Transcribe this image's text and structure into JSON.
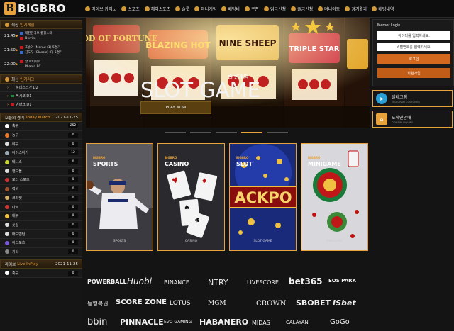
{
  "header": {
    "logo_mark": "B",
    "logo_text": "BIGBRO",
    "nav": [
      "라이브 카지노",
      "스포츠",
      "해외스포츠",
      "슬롯",
      "미니게임",
      "배팅비",
      "쿠폰",
      "입금신청",
      "출금신청",
      "머니이동",
      "경기결과",
      "배팅내역"
    ]
  },
  "sidebar": {
    "live_games_title": "최신",
    "live_games_accent": "인기게임",
    "live_games": [
      {
        "time": "21:45",
        "home": "대전한국보 캠핑스터",
        "away": "Derrito"
      },
      {
        "time": "21:50",
        "home": "조슈아 (Manu) (1) 5경기",
        "away": "김도우 (Classic) (F) 5경기"
      },
      {
        "time": "22:00",
        "home": "알 마티파르",
        "away": "Pharco FC"
      }
    ],
    "leagues_title": "최신",
    "leagues_accent": "인기리그",
    "leagues": [
      "분데스리가 D2",
      "멕시코 D1",
      "덴마크 D1"
    ],
    "today_title": "오늘의 경기",
    "today_accent": "Today Match",
    "today_date": "2021-11-25",
    "sports": [
      {
        "name": "축구",
        "count": "252",
        "color": "#ffffff"
      },
      {
        "name": "농구",
        "count": "0",
        "color": "#e8782c"
      },
      {
        "name": "야구",
        "count": "0",
        "color": "#dddddd"
      },
      {
        "name": "아이스하키",
        "count": "12",
        "color": "#9aa7b5"
      },
      {
        "name": "테니스",
        "count": "0",
        "color": "#c8d43a"
      },
      {
        "name": "핸드볼",
        "count": "0",
        "color": "#dddddd"
      },
      {
        "name": "모터 스포츠",
        "count": "0",
        "color": "#cc3333"
      },
      {
        "name": "럭비",
        "count": "0",
        "color": "#a0522d"
      },
      {
        "name": "크리켓",
        "count": "0",
        "color": "#d7b36a"
      },
      {
        "name": "다트",
        "count": "0",
        "color": "#cc3333"
      },
      {
        "name": "배구",
        "count": "0",
        "color": "#f0c040"
      },
      {
        "name": "풋살",
        "count": "0",
        "color": "#e0e0e0"
      },
      {
        "name": "배드민턴",
        "count": "0",
        "color": "#dddddd"
      },
      {
        "name": "이스포츠",
        "count": "0",
        "color": "#7a5ad8"
      },
      {
        "name": "기타",
        "count": "0",
        "color": "#888888"
      }
    ],
    "inplay_title": "라이브",
    "inplay_accent": "Live InPlay",
    "inplay_date": "2021-11-25",
    "inplay_sports": [
      {
        "name": "축구",
        "count": "0",
        "color": "#ffffff"
      }
    ]
  },
  "banner": {
    "kor_title": "슬롯게임",
    "title": "SLOT GAME",
    "button": "PLAY NOW",
    "slot_signs": [
      "GOD OF FORTUNE",
      "BLAZING HOT",
      "NINE SHEEP",
      "TRIPLE STAR"
    ]
  },
  "login": {
    "title": "Memer Login",
    "id_placeholder": "아이디를 입력하세요.",
    "pw_placeholder": "비밀번호를 입력하세요.",
    "login_btn": "로그인",
    "join_btn": "회원가입"
  },
  "telegram": {
    "title": "텔레그램",
    "sub": "TELEGRAM CUSTOMER"
  },
  "domain": {
    "title": "도메인안내",
    "sub": "DOMAIN INQUIRY"
  },
  "cards": [
    {
      "brand": "BIGBRO",
      "name": "SPORTS",
      "foot": "SPORTS"
    },
    {
      "brand": "BIGBRO",
      "name": "CASINO",
      "foot": "CASINO"
    },
    {
      "brand": "BIGBRO",
      "name": "SLOT",
      "foot": "SLOT GAME",
      "sign": "ACKPO"
    },
    {
      "brand": "BIGBRO",
      "name": "MINIGAME",
      "foot": "MINIGAME"
    }
  ],
  "partners": {
    "row1": [
      "POWERBALL",
      "Huobi",
      "BINANCE",
      "NTRY",
      "LIVESCORE",
      "bet365",
      "EOS PARK"
    ],
    "row2": [
      "동행복권",
      "SCORE ZONE",
      "LOTUS",
      "MGM",
      "CROWN",
      "SBOBET",
      "ISbet"
    ],
    "row3": [
      "bbin",
      "PINNACLE",
      "EVO GAMING",
      "HABANERO",
      "MIDAS",
      "CALAYAN",
      "GoGo"
    ]
  },
  "colors": {
    "accent": "#e8a33c",
    "login_button": "#d2691e",
    "telegram": "#2a9fd6"
  }
}
